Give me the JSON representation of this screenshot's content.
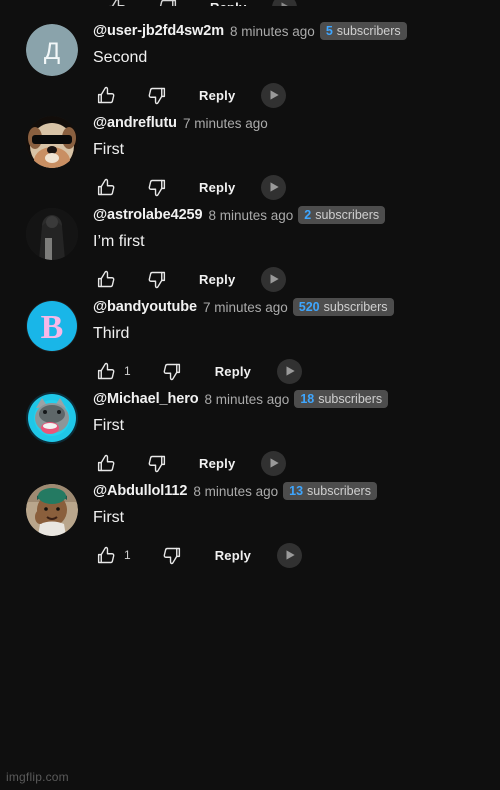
{
  "watermark": "imgflip.com",
  "theme": {
    "background": "#0f0f0f",
    "text_primary": "#f1f1f1",
    "text_secondary": "#aaaaaa",
    "badge_background": "#4d4d4d",
    "badge_count": "#3ea6ff",
    "remix_background": "#313131"
  },
  "labels": {
    "reply": "Reply",
    "subscribers": "subscribers",
    "like_icon": "thumbs-up-icon",
    "dislike_icon": "thumbs-down-icon",
    "remix_icon": "remix-play-icon"
  },
  "comments": [
    {
      "author": "@user-jb2fd4sw2m",
      "time": "8 minutes ago",
      "subscriber_count": "5",
      "text": "Second",
      "like_count": "",
      "reply": "Reply",
      "avatar": "letter-avatar-cyrillic-de"
    },
    {
      "author": "@andreflutu",
      "time": "7 minutes ago",
      "subscriber_count": "",
      "text": "First",
      "like_count": "",
      "reply": "Reply",
      "avatar": "dog-with-sunglasses-photo"
    },
    {
      "author": "@astrolabe4259",
      "time": "8 minutes ago",
      "subscriber_count": "2",
      "text": "I’m first",
      "like_count": "",
      "reply": "Reply",
      "avatar": "dark-ghost-figure-photo"
    },
    {
      "author": "@bandyoutube",
      "time": "7 minutes ago",
      "subscriber_count": "520",
      "text": "Third",
      "like_count": "1",
      "reply": "Reply",
      "avatar": "letter-b-cyan-logo"
    },
    {
      "author": "@Michael_hero",
      "time": "8 minutes ago",
      "subscriber_count": "18",
      "text": "First",
      "like_count": "",
      "reply": "Reply",
      "avatar": "wolf-photo"
    },
    {
      "author": "@Abdullol112",
      "time": "8 minutes ago",
      "subscriber_count": "13",
      "text": "First",
      "like_count": "1",
      "reply": "Reply",
      "avatar": "child-with-cap-photo"
    }
  ]
}
